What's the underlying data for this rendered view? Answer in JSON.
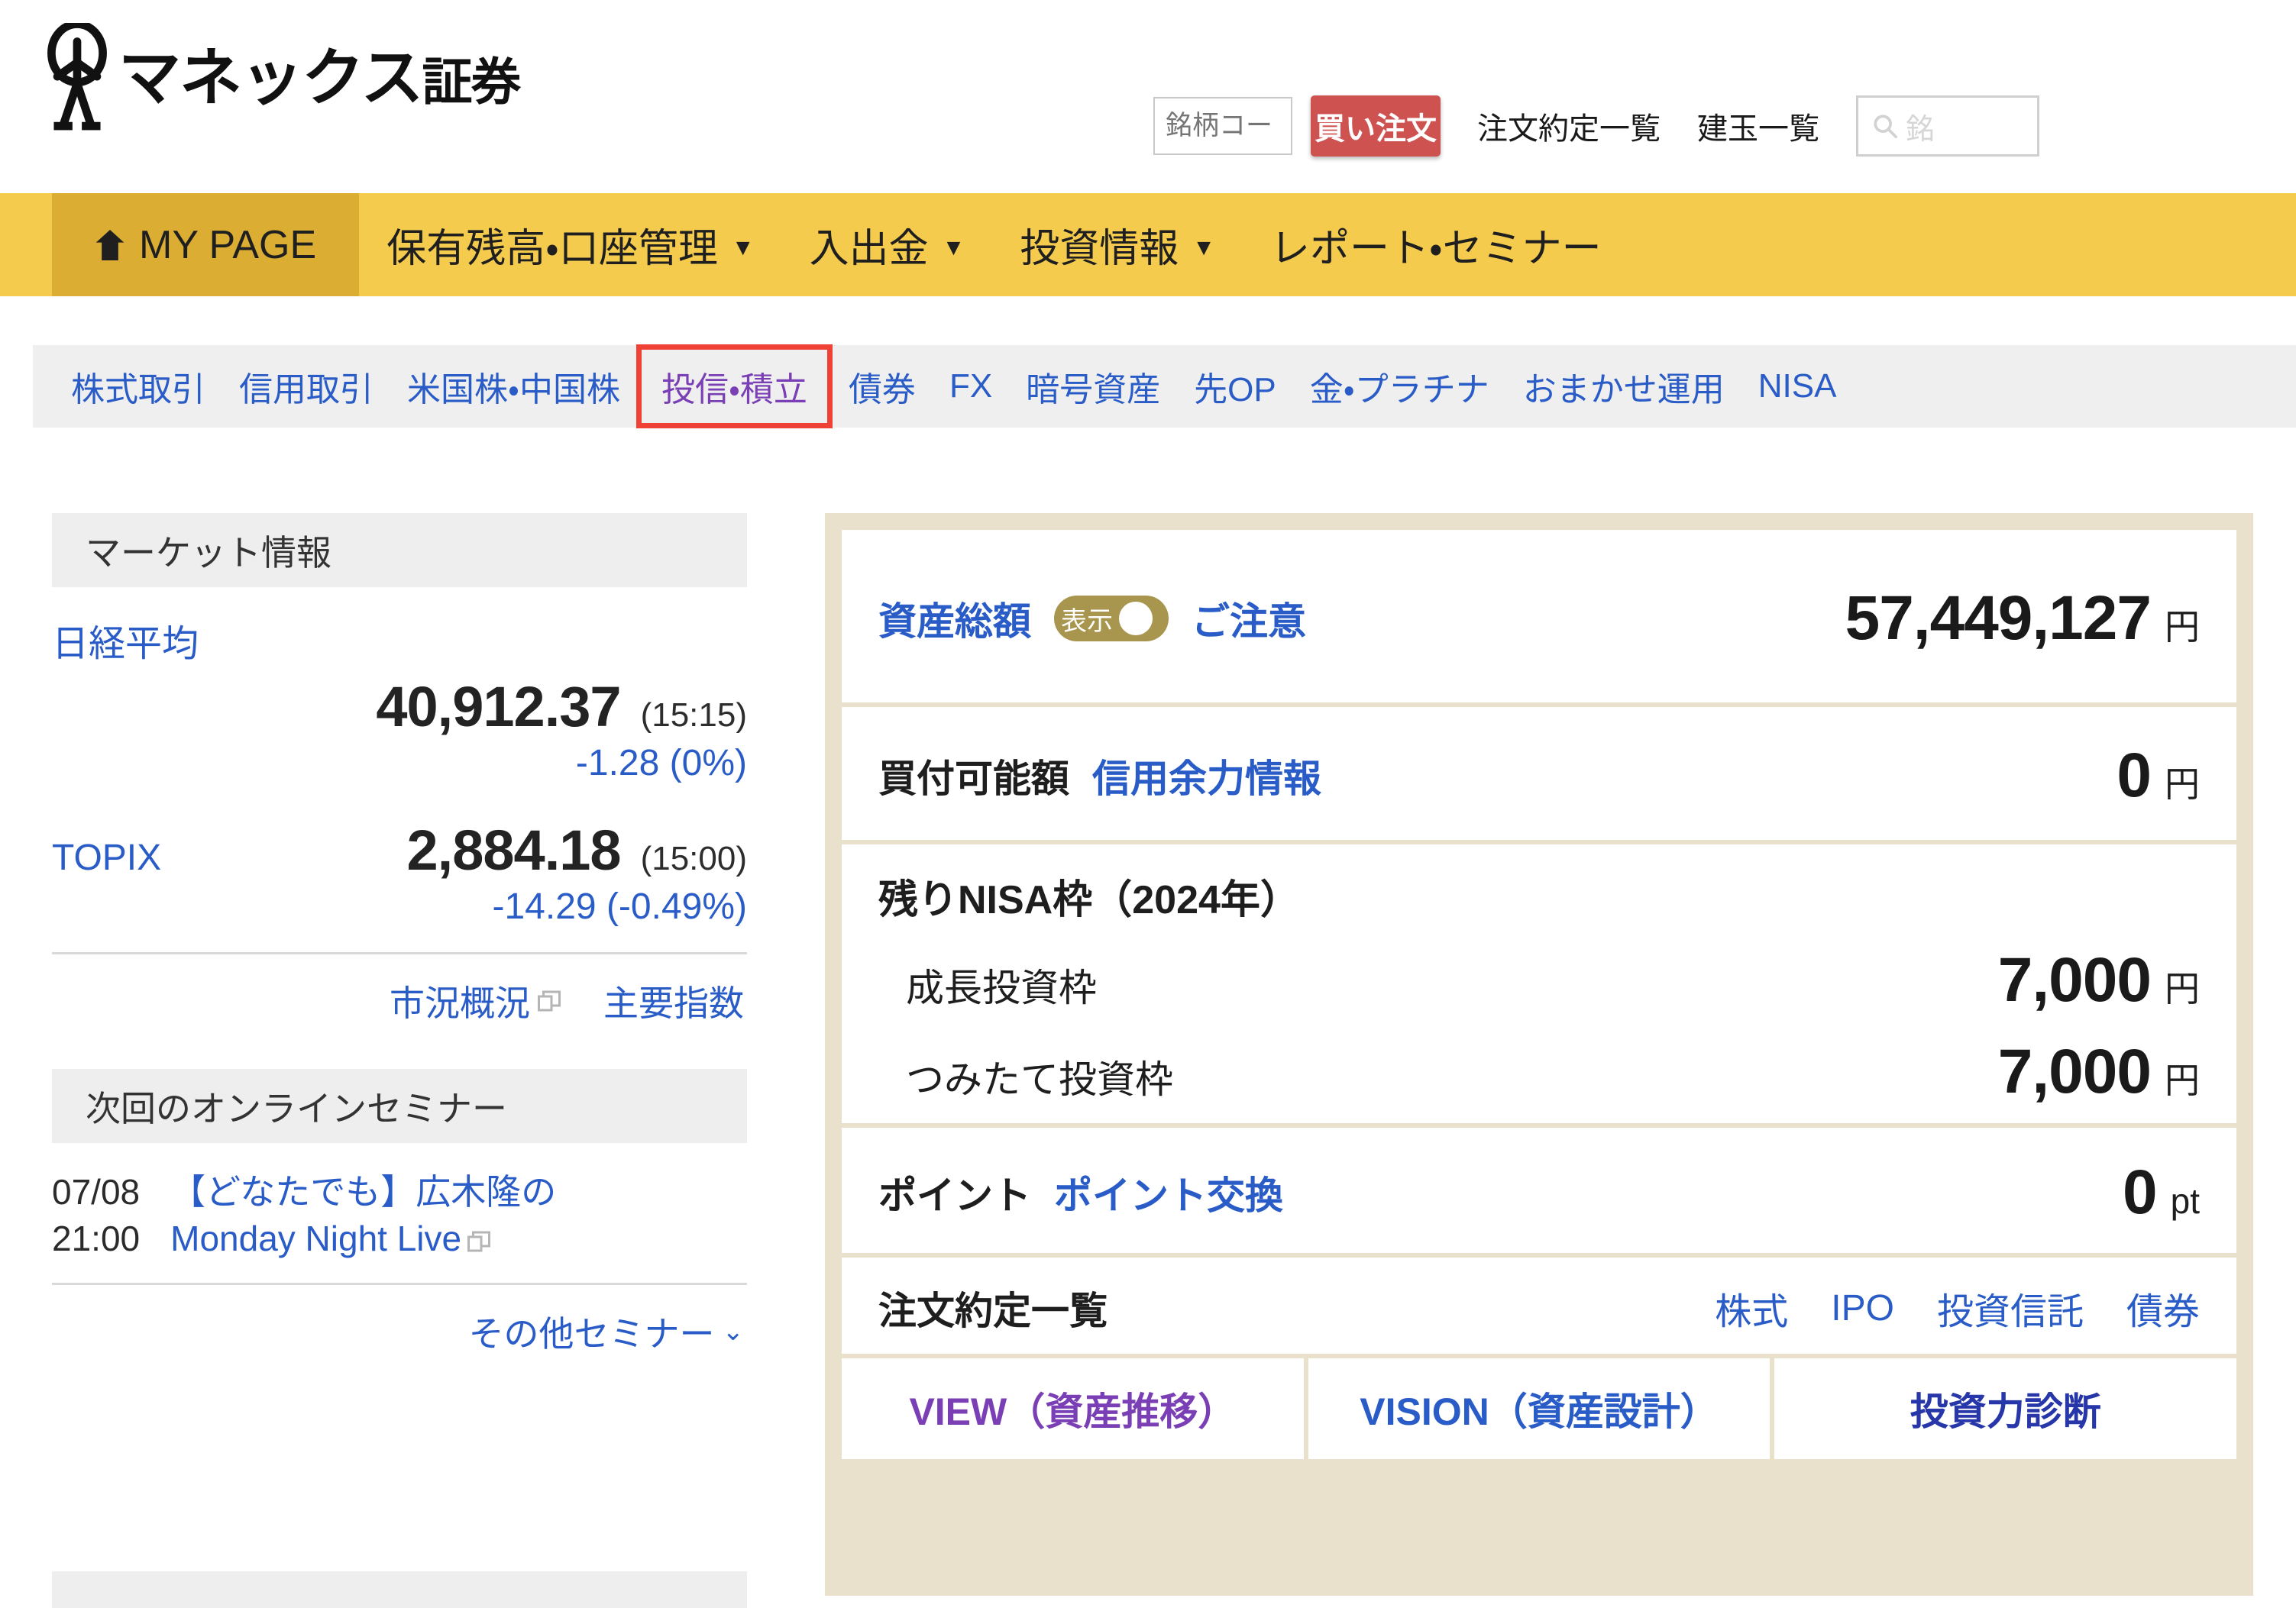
{
  "brand": {
    "name_main": "マネックス",
    "name_sub": "証券",
    "logo_icon": "stick-figure-logo-icon"
  },
  "header": {
    "code_input_placeholder": "銘柄コード",
    "code_input_value": "",
    "buy_button_label": "買い注文",
    "links": [
      {
        "label": "注文約定一覧"
      },
      {
        "label": "建玉一覧"
      }
    ],
    "search": {
      "placeholder": "銘",
      "icon": "search-icon"
    }
  },
  "global_nav": [
    {
      "label": "MY PAGE",
      "icon": "home-icon",
      "active": true,
      "has_caret": false
    },
    {
      "label": "保有残高・口座管理",
      "active": false,
      "has_caret": true
    },
    {
      "label": "入出金",
      "active": false,
      "has_caret": true
    },
    {
      "label": "投資情報",
      "active": false,
      "has_caret": true
    },
    {
      "label": "レポート・セミナー",
      "active": false,
      "has_caret": false
    }
  ],
  "sub_nav": [
    {
      "label": "株式取引",
      "state": "normal"
    },
    {
      "label": "信用取引",
      "state": "normal"
    },
    {
      "label": "米国株・中国株",
      "state": "normal"
    },
    {
      "label": "投信・積立",
      "state": "visited",
      "highlighted": true
    },
    {
      "label": "債券",
      "state": "normal"
    },
    {
      "label": "FX",
      "state": "normal"
    },
    {
      "label": "暗号資産",
      "state": "normal"
    },
    {
      "label": "先OP",
      "state": "normal"
    },
    {
      "label": "金・プラチナ",
      "state": "normal"
    },
    {
      "label": "おまかせ運用",
      "state": "normal"
    },
    {
      "label": "NISA",
      "state": "normal"
    }
  ],
  "sidebar": {
    "market": {
      "title": "マーケット情報",
      "indices": [
        {
          "name": "日経平均",
          "value": "40,912.37",
          "time": "(15:15)",
          "change": "-1.28 (0%)"
        },
        {
          "name": "TOPIX",
          "value": "2,884.18",
          "time": "(15:00)",
          "change": "-14.29 (-0.49%)"
        }
      ],
      "links": [
        {
          "label": "市況概況",
          "icon": "new-window-icon"
        },
        {
          "label": "主要指数",
          "icon": ""
        }
      ]
    },
    "seminar": {
      "title": "次回のオンラインセミナー",
      "date_line1": "07/08",
      "date_line2": "21:00",
      "title_line1": "【どなたでも】広木隆の",
      "title_line2": "Monday Night Live",
      "title_icon": "new-window-icon",
      "more_label": "その他セミナー",
      "more_icon": "chevron-down-icon"
    }
  },
  "main": {
    "total_assets": {
      "label": "資産総額",
      "toggle_label": "表示",
      "toggle_on": true,
      "note_link": "ご注意",
      "value": "57,449,127",
      "unit": "円"
    },
    "buying_power": {
      "label": "買付可能額",
      "link": "信用余力情報",
      "value": "0",
      "unit": "円"
    },
    "nisa": {
      "title": "残りNISA枠（2024年）",
      "rows": [
        {
          "label": "成長投資枠",
          "value": "7,000",
          "unit": "円"
        },
        {
          "label": "つみたて投資枠",
          "value": "7,000",
          "unit": "円"
        }
      ]
    },
    "points": {
      "label": "ポイント",
      "link": "ポイント交換",
      "value": "0",
      "unit": "pt"
    },
    "orders": {
      "label": "注文約定一覧",
      "links": [
        {
          "label": "株式"
        },
        {
          "label": "IPO"
        },
        {
          "label": "投資信託"
        },
        {
          "label": "債券"
        }
      ]
    },
    "tiles": [
      {
        "label": "VIEW（資産推移）",
        "style": "purple"
      },
      {
        "label": "VISION（資産設計）",
        "style": "blue"
      },
      {
        "label": "投資力診断",
        "style": "navy"
      }
    ]
  },
  "colors": {
    "brand_gold": "#f5cb4d",
    "active_gold": "#dbae33",
    "buy_red": "#cd5250",
    "link_blue": "#2a5cc8",
    "visited_purple": "#7a3fb5",
    "highlight_red": "#ef4136",
    "card_frame": "#e9e1cb",
    "toggle_gold": "#a8954e"
  }
}
